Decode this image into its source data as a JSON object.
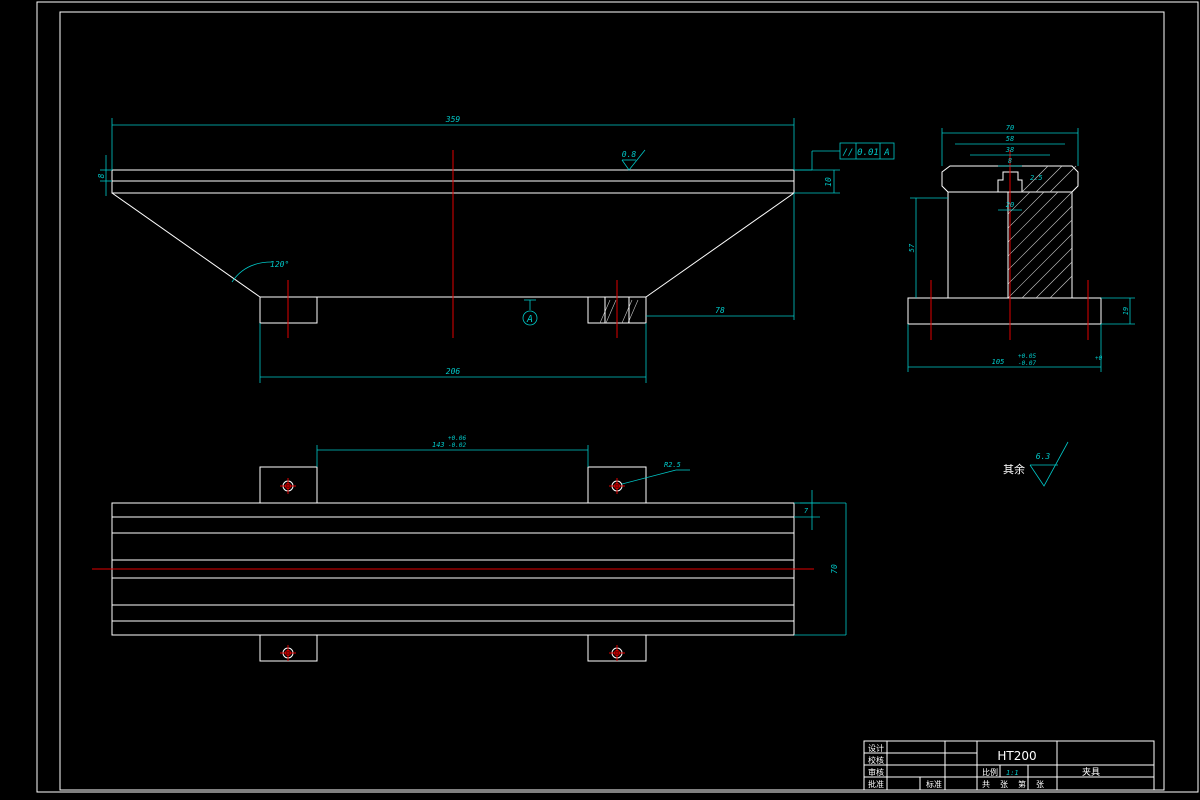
{
  "dims": {
    "top_overall_width": "359",
    "top_plate_height": "8",
    "top_flange_height": "10",
    "bottom_span": "206",
    "right_offset": "78",
    "angle": "120°",
    "side_width_70": "70",
    "side_width_58": "58",
    "side_width_38": "38",
    "side_slot_8": "8",
    "side_chamfer": "2.5",
    "side_inner_20": "20",
    "side_height_57": "57",
    "side_base_height": "19",
    "side_base_width": "105",
    "side_base_tol_upper": "+0.05",
    "side_base_tol_lower": "-0.07",
    "side_base_zero": "+0",
    "plan_hole_spacing": "143",
    "plan_hole_tol_upper": "+0.06",
    "plan_hole_tol_lower": "-0.02",
    "plan_hole_radius": "R2.5",
    "plan_slot_7": "7",
    "plan_width_70": "70"
  },
  "surface": {
    "top_roughness": "0.8",
    "rest_roughness": "6.3",
    "rest_label": "其余"
  },
  "tolerance": {
    "symbol": "//",
    "value": "0.01",
    "datum": "A"
  },
  "datum_label": "A",
  "title_block": {
    "material": "HT200",
    "ratio_label": "比例",
    "ratio_value": "1:1",
    "part_name": "夹具",
    "labels": [
      "设计",
      "校核",
      "审核",
      "批准"
    ],
    "footer": [
      "共",
      "张",
      "第",
      "张"
    ],
    "bottom_mid": "标准"
  }
}
